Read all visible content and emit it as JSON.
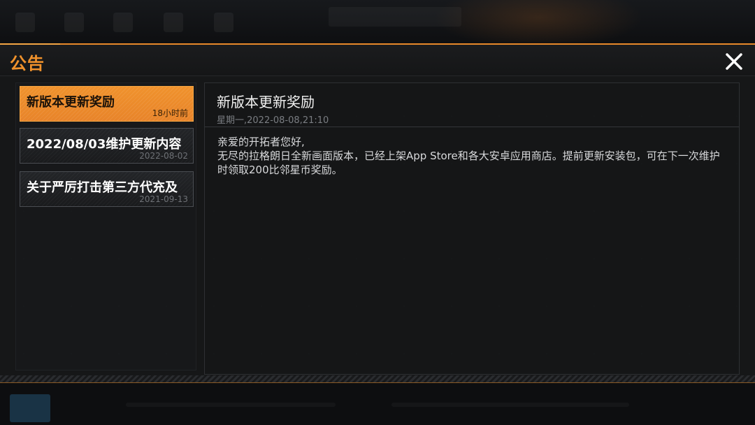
{
  "panel": {
    "title": "公告",
    "close_icon": "close-icon"
  },
  "colors": {
    "accent": "#f0922c",
    "panel_bg": "#161718",
    "text_primary": "#f2f2f2",
    "text_muted": "#7a7d82"
  },
  "announcements": [
    {
      "title": "新版本更新奖励",
      "date": "18小时前",
      "selected": true
    },
    {
      "title": "2022/08/03维护更新内容",
      "date": "2022-08-02",
      "selected": false
    },
    {
      "title": "关于严厉打击第三方代充及",
      "date": "2021-09-13",
      "selected": false
    }
  ],
  "detail": {
    "title": "新版本更新奖励",
    "meta": "星期一,2022-08-08,21:10",
    "body": [
      "亲爱的开拓者您好,",
      "无尽的拉格朗日全新画面版本，已经上架App Store和各大安卓应用商店。提前更新安装包，可在下一次维护时领取200比邻星币奖励。"
    ]
  }
}
